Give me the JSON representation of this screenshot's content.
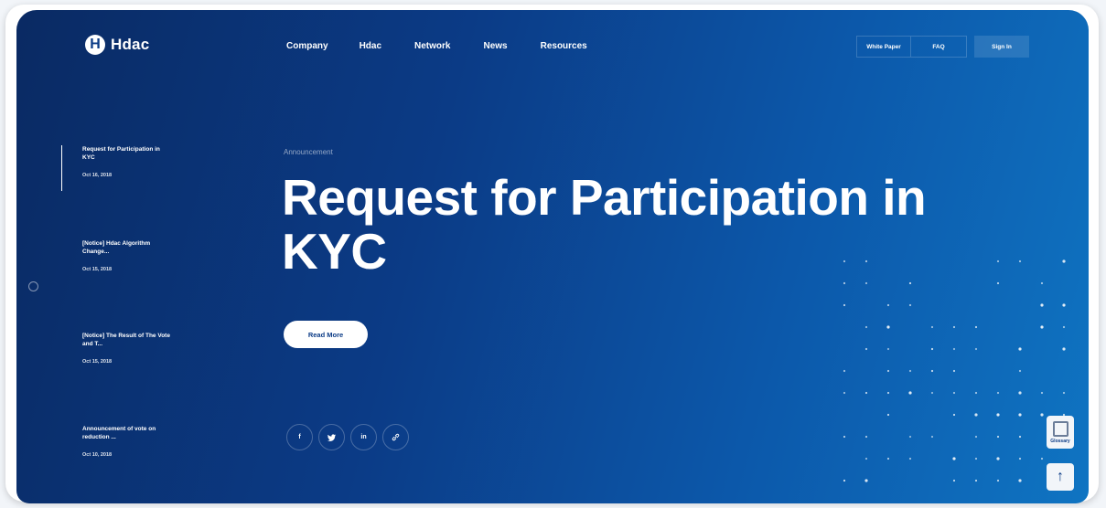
{
  "brand": {
    "name": "Hdac"
  },
  "nav": {
    "items": [
      "Company",
      "Hdac",
      "Network",
      "News",
      "Resources"
    ]
  },
  "actions": {
    "white_paper": "White Paper",
    "faq": "FAQ",
    "sign_in": "Sign In"
  },
  "sidebar": {
    "items": [
      {
        "title": "Request for Participation in KYC",
        "date": "Oct 16, 2018"
      },
      {
        "title": "[Notice] Hdac Algorithm Change...",
        "date": "Oct 15, 2018"
      },
      {
        "title": "[Notice] The Result of The Vote and T...",
        "date": "Oct 15, 2018"
      },
      {
        "title": "Announcement of vote on reduction ...",
        "date": "Oct 10, 2018"
      }
    ]
  },
  "main": {
    "category": "Announcement",
    "title": "Request for Participation in KYC",
    "read_more": "Read More"
  },
  "social": {
    "facebook": "f",
    "twitter": "t",
    "linkedin": "in",
    "link": "link-icon"
  },
  "float": {
    "glossary": "Glossary",
    "top": "↑"
  },
  "colors": {
    "bg_dark": "#0a2a63",
    "bg_light": "#0f74c2",
    "accent": "#ffffff"
  }
}
